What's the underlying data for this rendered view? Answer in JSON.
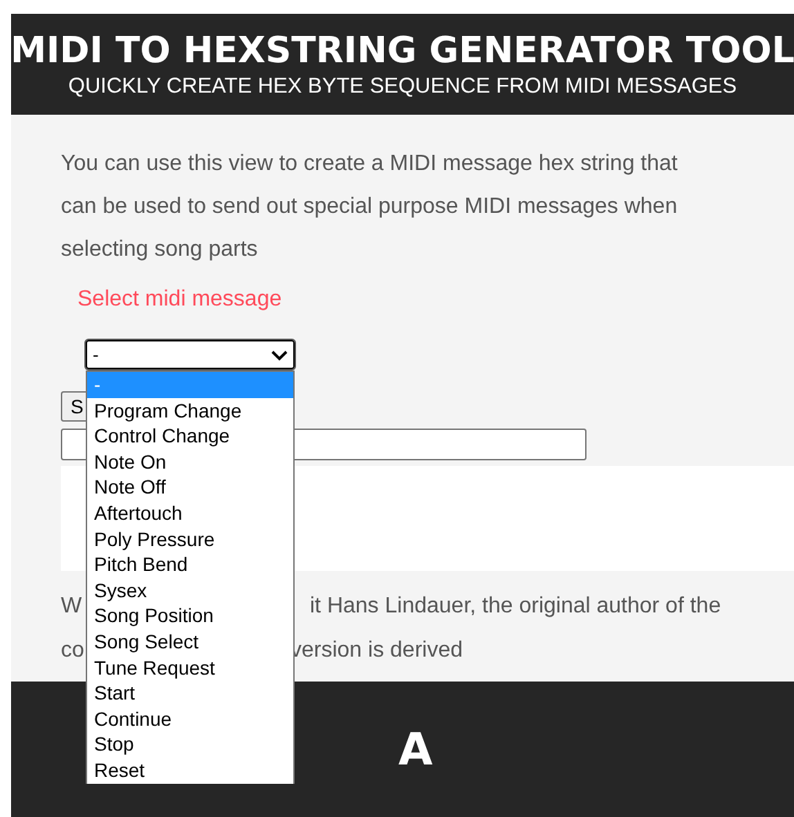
{
  "header": {
    "title": "MIDI TO HEXSTRING GENERATOR TOOL",
    "subtitle": "QUICKLY CREATE HEX BYTE SEQUENCE FROM MIDI MESSAGES"
  },
  "intro": [
    "You can use this view to create a MIDI message hex string that",
    "can be used to send out special purpose MIDI messages when",
    "selecting song parts"
  ],
  "select_label": "Select midi message",
  "select": {
    "value": "-",
    "expanded": true,
    "options": [
      {
        "label": "-",
        "selected": true
      },
      {
        "label": "Program Change",
        "selected": false
      },
      {
        "label": "Control Change",
        "selected": false
      },
      {
        "label": "Note On",
        "selected": false
      },
      {
        "label": "Note Off",
        "selected": false
      },
      {
        "label": "Aftertouch",
        "selected": false
      },
      {
        "label": "Poly Pressure",
        "selected": false
      },
      {
        "label": "Pitch Bend",
        "selected": false
      },
      {
        "label": "Sysex",
        "selected": false
      },
      {
        "label": "Song Position",
        "selected": false
      },
      {
        "label": "Song Select",
        "selected": false
      },
      {
        "label": "Tune Request",
        "selected": false
      },
      {
        "label": "Start",
        "selected": false
      },
      {
        "label": "Continue",
        "selected": false
      },
      {
        "label": "Stop",
        "selected": false
      },
      {
        "label": "Reset",
        "selected": false
      }
    ]
  },
  "button_label": "S",
  "credits": [
    [
      "W",
      "it Hans Lindauer, the original author of the"
    ],
    [
      "co",
      "version is derived"
    ]
  ],
  "footer": {
    "logo": "A"
  }
}
